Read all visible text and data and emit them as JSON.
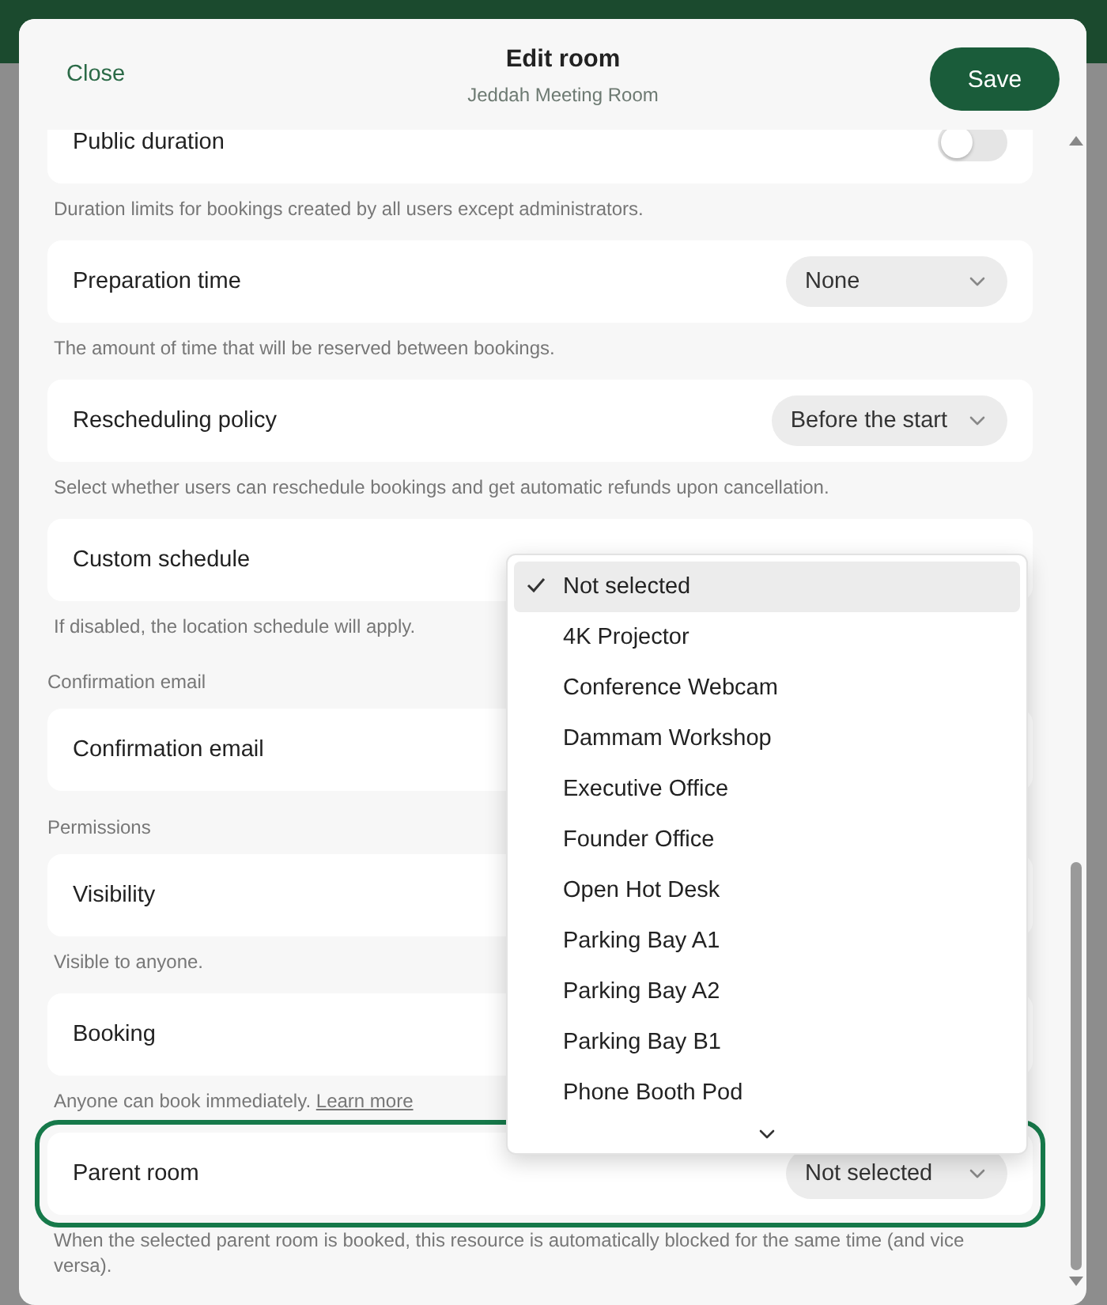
{
  "header": {
    "close": "Close",
    "title": "Edit room",
    "subtitle": "Jeddah Meeting Room",
    "save": "Save"
  },
  "items": [
    {
      "kind": "toggle",
      "label": "Public duration",
      "on": false,
      "description": "Duration limits for bookings created by all users except administrators."
    },
    {
      "kind": "select",
      "label": "Preparation time",
      "value": "None",
      "focused": false,
      "description": "The amount of time that will be reserved between bookings."
    },
    {
      "kind": "select",
      "label": "Rescheduling policy",
      "value": "Before the start",
      "focused": false,
      "description": "Select whether users can reschedule bookings and get automatic refunds upon cancellation."
    },
    {
      "kind": "plain",
      "label": "Custom schedule",
      "description": "If disabled, the location schedule will apply."
    },
    {
      "kind": "heading",
      "text": "Confirmation email"
    },
    {
      "kind": "plain",
      "label": "Confirmation email"
    },
    {
      "kind": "heading",
      "text": "Permissions"
    },
    {
      "kind": "plain",
      "label": "Visibility",
      "description": "Visible to anyone."
    },
    {
      "kind": "plain",
      "label": "Booking",
      "description": "Anyone can book immediately.",
      "link": "Learn more"
    },
    {
      "kind": "select",
      "label": "Parent room",
      "value": "Not selected",
      "focused": true,
      "description": "When the selected parent room is booked, this resource is automatically blocked for the same time (and vice versa)."
    }
  ],
  "dropdown": {
    "options": [
      {
        "label": "Not selected",
        "selected": true
      },
      {
        "label": "4K Projector",
        "selected": false
      },
      {
        "label": "Conference Webcam",
        "selected": false
      },
      {
        "label": "Dammam Workshop",
        "selected": false
      },
      {
        "label": "Executive Office",
        "selected": false
      },
      {
        "label": "Founder Office",
        "selected": false
      },
      {
        "label": "Open Hot Desk",
        "selected": false
      },
      {
        "label": "Parking Bay A1",
        "selected": false
      },
      {
        "label": "Parking Bay A2",
        "selected": false
      },
      {
        "label": "Parking Bay B1",
        "selected": false
      },
      {
        "label": "Phone Booth Pod",
        "selected": false
      }
    ]
  }
}
